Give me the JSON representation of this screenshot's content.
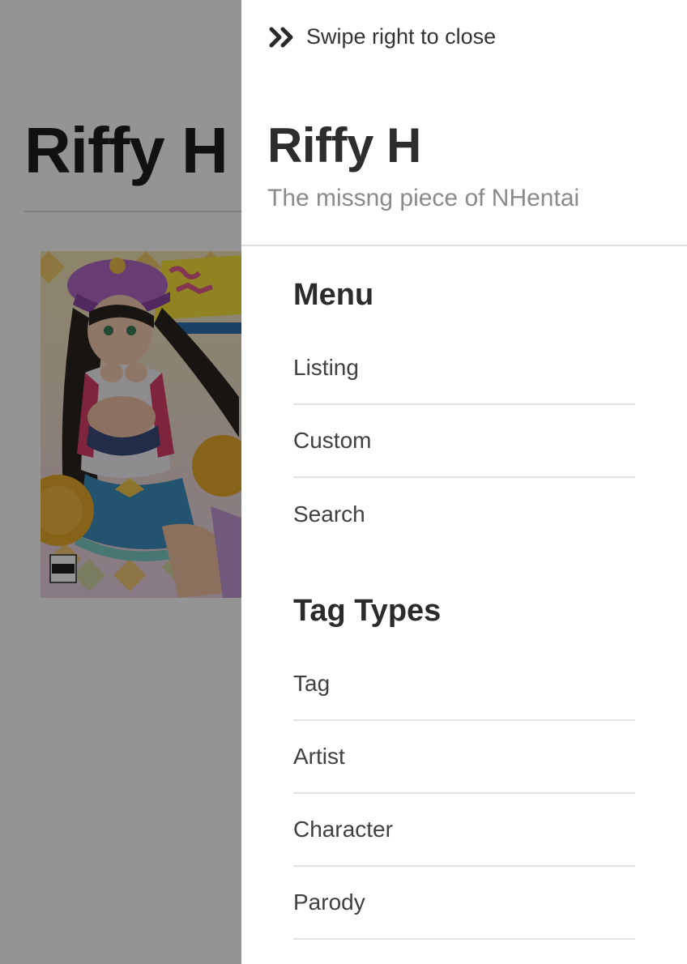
{
  "background": {
    "site_title": "Riffy H",
    "cover_image": "doujin-cover-illustration"
  },
  "drawer": {
    "swipe_hint": {
      "icon": "double-chevron-right-icon",
      "label": "Swipe right to close"
    },
    "title": "Riffy H",
    "subtitle": "The missng piece of NHentai",
    "menu": {
      "heading": "Menu",
      "items": [
        {
          "label": "Listing"
        },
        {
          "label": "Custom"
        },
        {
          "label": "Search"
        }
      ]
    },
    "tag_types": {
      "heading": "Tag Types",
      "items": [
        {
          "label": "Tag"
        },
        {
          "label": "Artist"
        },
        {
          "label": "Character"
        },
        {
          "label": "Parody"
        }
      ]
    }
  },
  "colors": {
    "overlay": "rgba(0,0,0,0.42)",
    "text_primary": "#2d2d2d",
    "text_secondary": "#8a8a8a",
    "divider": "#e2e2e2"
  }
}
